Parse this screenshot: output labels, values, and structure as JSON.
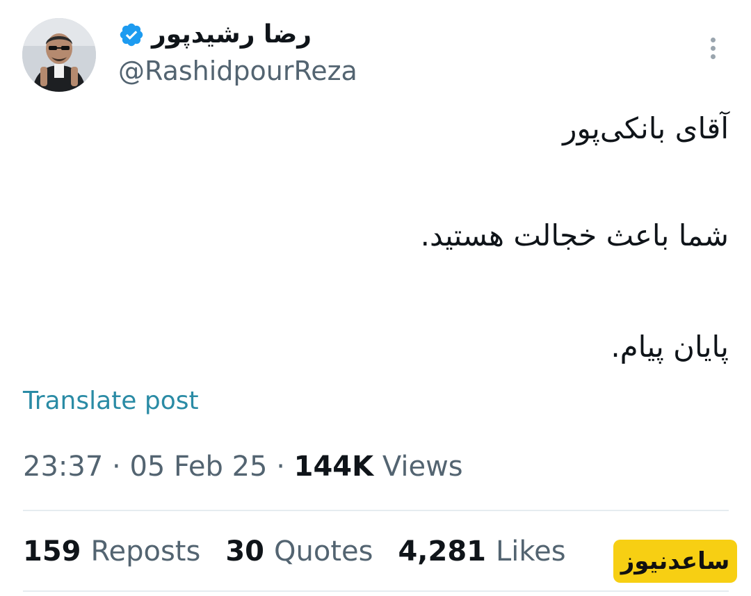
{
  "author": {
    "display_name": "رضا رشیدپور",
    "handle": "@RashidpourReza",
    "verified": true,
    "avatar_icon": "user-avatar-photo",
    "verified_icon": "verified-badge-icon"
  },
  "menu": {
    "icon": "more-vertical-icon"
  },
  "post": {
    "lines": [
      "آقای بانکی‌پور",
      "شما باعث خجالت هستید.",
      "پایان پیام."
    ],
    "translate_label": "Translate post"
  },
  "meta": {
    "time": "23:37",
    "separator": "·",
    "date": "05 Feb 25",
    "views_count": "144K",
    "views_label": "Views"
  },
  "stats": {
    "reposts_count": "159",
    "reposts_label": "Reposts",
    "quotes_count": "30",
    "quotes_label": "Quotes",
    "likes_count": "4,281",
    "likes_label": "Likes"
  },
  "watermark": {
    "text": "ساعدنیوز",
    "color": "#f7cf13"
  },
  "colors": {
    "link": "#2a8ba5",
    "secondary_text": "#536471",
    "primary_text": "#0f1419",
    "verified": "#1d9bf0"
  }
}
